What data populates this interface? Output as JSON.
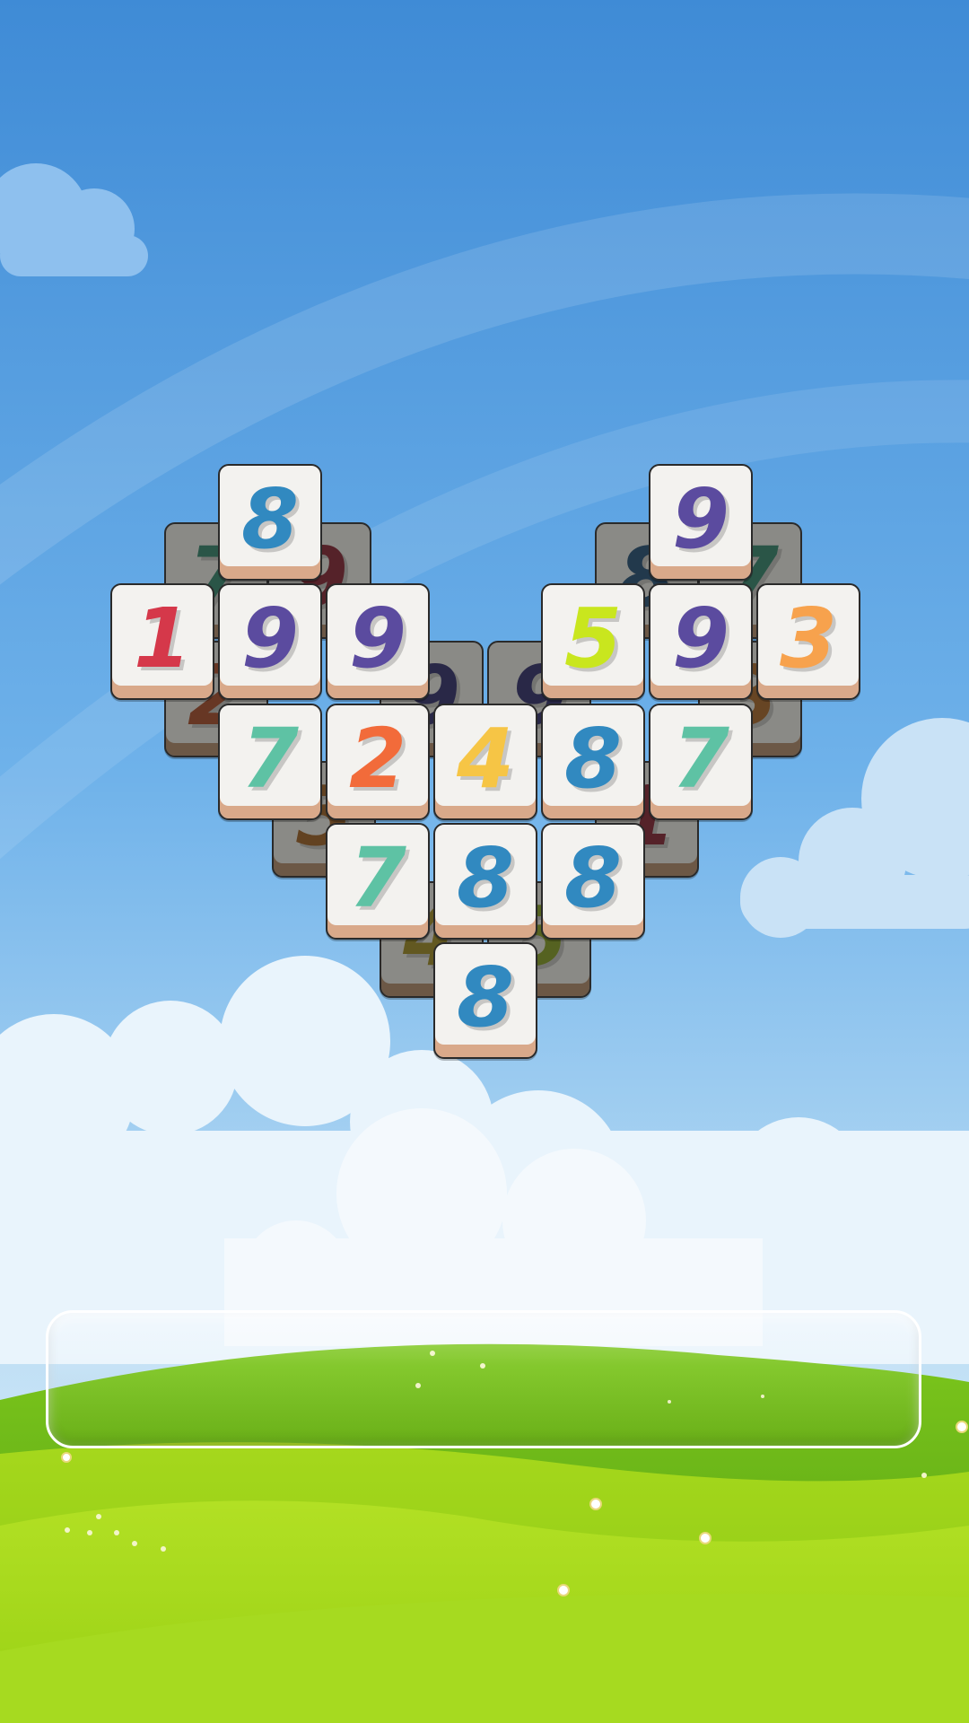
{
  "colors": {
    "sky_top": "#3f8fdc",
    "sky_bottom": "#b7dcf5",
    "grass": "#8ccc1e",
    "tile_face": "#f3f2ef",
    "tile_base": "#d9a98a"
  },
  "board": {
    "shape": "heart",
    "tiles": [
      {
        "value": "7",
        "color": "#2f8a6e",
        "layer": "under"
      },
      {
        "value": "9",
        "color": "#8a1f2e",
        "layer": "under"
      },
      {
        "value": "8",
        "color": "#1d4e78",
        "layer": "under"
      },
      {
        "value": "7",
        "color": "#2f8a6e",
        "layer": "under"
      },
      {
        "value": "2",
        "color": "#b04a22",
        "layer": "under"
      },
      {
        "value": "9",
        "color": "#2e2a6e",
        "layer": "under"
      },
      {
        "value": "9",
        "color": "#2e2a6e",
        "layer": "under"
      },
      {
        "value": "3",
        "color": "#b06a22",
        "layer": "under"
      },
      {
        "value": "5",
        "color": "#a8621e",
        "layer": "under"
      },
      {
        "value": "1",
        "color": "#8a1f2e",
        "layer": "under"
      },
      {
        "value": "4",
        "color": "#a8921e",
        "layer": "under"
      },
      {
        "value": "5",
        "color": "#8aa81e",
        "layer": "under"
      },
      {
        "value": "8",
        "color": "#3189c0",
        "layer": "top"
      },
      {
        "value": "9",
        "color": "#5b4b9f",
        "layer": "top"
      },
      {
        "value": "1",
        "color": "#d5384a",
        "layer": "top"
      },
      {
        "value": "9",
        "color": "#5b4b9f",
        "layer": "top"
      },
      {
        "value": "9",
        "color": "#5b4b9f",
        "layer": "top"
      },
      {
        "value": "5",
        "color": "#c9e61e",
        "layer": "top"
      },
      {
        "value": "9",
        "color": "#5b4b9f",
        "layer": "top"
      },
      {
        "value": "3",
        "color": "#f7a24d",
        "layer": "top"
      },
      {
        "value": "7",
        "color": "#5ec2a4",
        "layer": "top"
      },
      {
        "value": "2",
        "color": "#f26b3a",
        "layer": "top"
      },
      {
        "value": "4",
        "color": "#f6c545",
        "layer": "top"
      },
      {
        "value": "8",
        "color": "#3189c0",
        "layer": "top"
      },
      {
        "value": "7",
        "color": "#5ec2a4",
        "layer": "top"
      },
      {
        "value": "7",
        "color": "#5ec2a4",
        "layer": "top"
      },
      {
        "value": "8",
        "color": "#3189c0",
        "layer": "top"
      },
      {
        "value": "8",
        "color": "#3189c0",
        "layer": "top"
      },
      {
        "value": "8",
        "color": "#3189c0",
        "layer": "top"
      }
    ]
  },
  "tray": {
    "slots_filled": 0
  }
}
